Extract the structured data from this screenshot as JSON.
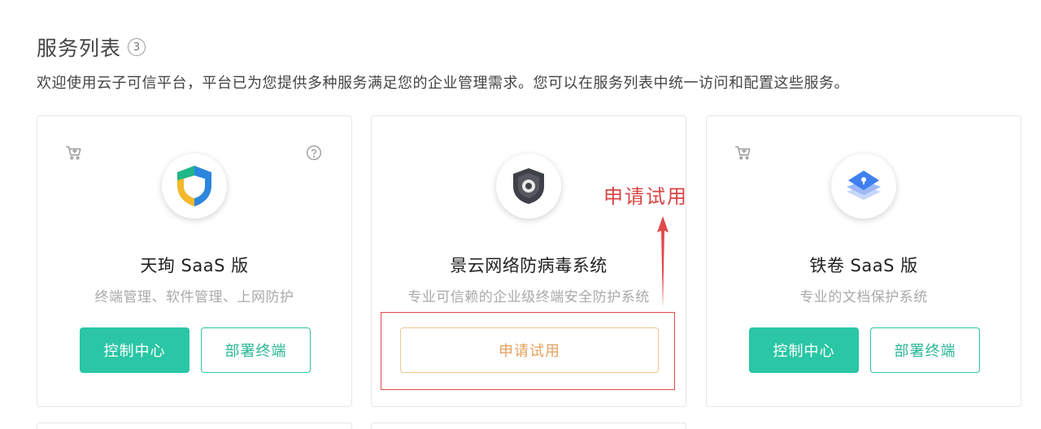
{
  "header": {
    "title": "服务列表",
    "count": "3",
    "intro": "欢迎使用云子可信平台，平台已为您提供多种服务满足您的企业管理需求。您可以在服务列表中统一访问和配置这些服务。"
  },
  "cards": [
    {
      "title": "天珣 SaaS 版",
      "desc": "终端管理、软件管理、上网防护",
      "primary_label": "控制中心",
      "secondary_label": "部署终端",
      "icons": [
        "cart-icon",
        "help-icon",
        "shield-logo-icon"
      ]
    },
    {
      "title": "景云网络防病毒系统",
      "desc": "专业可信赖的企业级终端安全防护系统",
      "trial_label": "申请试用",
      "icons": [
        "antivirus-logo-icon"
      ]
    },
    {
      "title": "铁卷 SaaS 版",
      "desc": "专业的文档保护系统",
      "primary_label": "控制中心",
      "secondary_label": "部署终端",
      "icons": [
        "cart-icon",
        "document-lock-logo-icon"
      ]
    }
  ],
  "annotation": {
    "text": "申请试用",
    "color": "#d94343"
  },
  "colors": {
    "accent": "#2ac6a5",
    "trial": "#e4a15d",
    "annotation": "#e04a4a"
  }
}
